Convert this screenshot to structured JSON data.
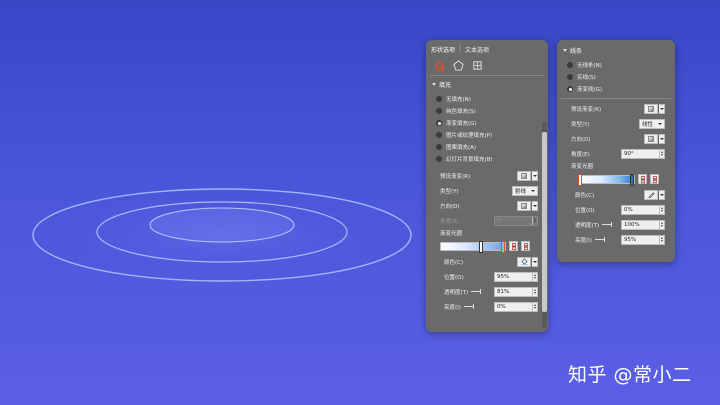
{
  "colors": {
    "background_top": "#3747c6",
    "background_bottom": "#5b5fe6",
    "panel": "#6a6a6a",
    "fill_icon": "#e0502a",
    "ring": "#a9c1ff"
  },
  "panel_left": {
    "tabs": [
      "形状选项",
      "文本选项"
    ],
    "icons": [
      "fill-line-icon",
      "effects-pentagon-icon",
      "size-properties-icon"
    ],
    "section_title": "填充",
    "options": [
      {
        "label": "无填充(N)",
        "selected": false
      },
      {
        "label": "纯色填充(S)",
        "selected": false
      },
      {
        "label": "渐变填充(G)",
        "selected": true
      },
      {
        "label": "图片或纹理填充(P)",
        "selected": false
      },
      {
        "label": "图案填充(A)",
        "selected": false
      },
      {
        "label": "幻灯片背景填充(B)",
        "selected": false
      }
    ],
    "preset_label": "预设渐变(R)",
    "type_label": "类型(Y)",
    "type_value": "射线",
    "direction_label": "方向(D)",
    "angle_label": "角度(E)",
    "angle_value": "0°",
    "stops_label": "渐变光圈",
    "color_label": "颜色(C)",
    "position_label": "位置(O)",
    "position_value": "95%",
    "transparency_label": "透明度(T)",
    "transparency_value": "81%",
    "brightness_label": "亮度(I)",
    "brightness_value": "0%"
  },
  "panel_right": {
    "section_title": "线条",
    "options": [
      {
        "label": "无线条(N)",
        "selected": false
      },
      {
        "label": "实线(S)",
        "selected": false
      },
      {
        "label": "渐变线(G)",
        "selected": true
      }
    ],
    "preset_label": "预设渐变(R)",
    "type_label": "类型(Y)",
    "type_value": "线性",
    "direction_label": "方向(D)",
    "angle_label": "角度(E)",
    "angle_value": "90°",
    "stops_label": "渐变光圈",
    "color_label": "颜色(C)",
    "position_label": "位置(O)",
    "position_value": "0%",
    "transparency_label": "透明度(T)",
    "transparency_value": "100%",
    "brightness_label": "亮度(I)",
    "brightness_value": "95%"
  },
  "watermark": "知乎 @常小二"
}
